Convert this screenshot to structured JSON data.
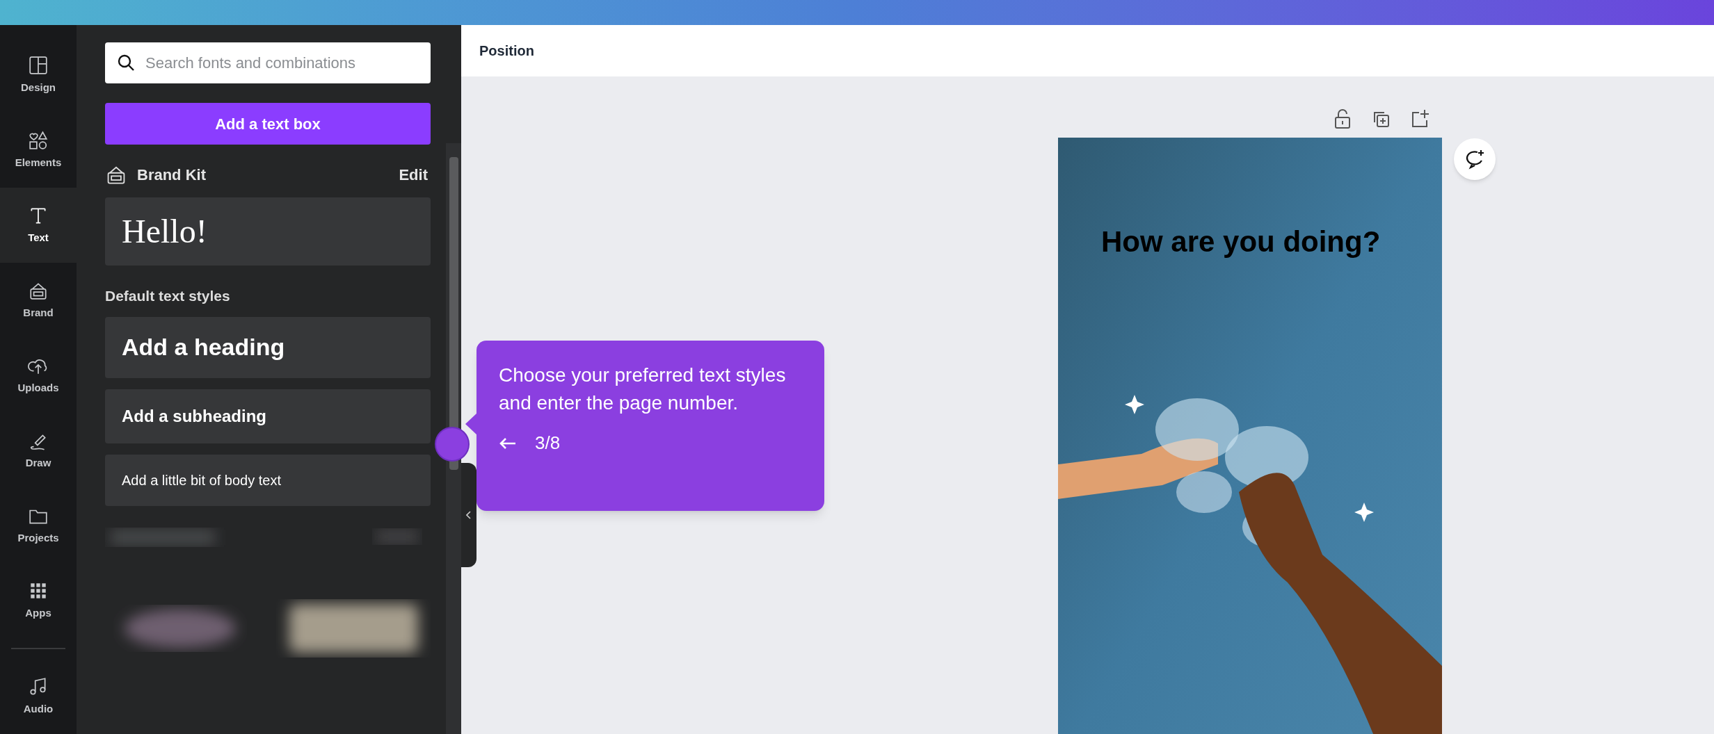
{
  "rail": [
    {
      "label": "Design",
      "selected": false
    },
    {
      "label": "Elements",
      "selected": false
    },
    {
      "label": "Text",
      "selected": true
    },
    {
      "label": "Brand",
      "selected": false
    },
    {
      "label": "Uploads",
      "selected": false
    },
    {
      "label": "Draw",
      "selected": false
    },
    {
      "label": "Projects",
      "selected": false
    },
    {
      "label": "Apps",
      "selected": false
    },
    {
      "label": "Audio",
      "selected": false
    }
  ],
  "panel": {
    "search": {
      "placeholder": "Search fonts and combinations"
    },
    "add_button": "Add a text box",
    "brand_kit": {
      "title": "Brand Kit",
      "action": "Edit",
      "sample": "Hello!"
    },
    "section_title": "Default text styles",
    "styles": [
      {
        "kind": "heading",
        "label": "Add a heading"
      },
      {
        "kind": "subheading",
        "label": "Add a subheading"
      },
      {
        "kind": "body",
        "label": "Add a little bit of body text"
      }
    ]
  },
  "toolbar": {
    "label": "Position"
  },
  "canvas": {
    "headline": "How are you doing?"
  },
  "tooltip": {
    "text": "Choose your preferred text styles and enter the page number.",
    "step": "3/8"
  }
}
